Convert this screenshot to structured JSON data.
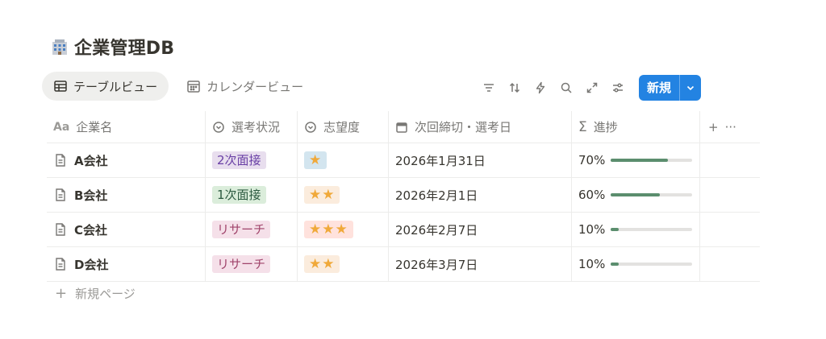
{
  "page": {
    "title": "企業管理DB",
    "title_icon": "office-building-icon"
  },
  "tabs": [
    {
      "label": "テーブルビュー",
      "icon": "table-icon",
      "active": true
    },
    {
      "label": "カレンダービュー",
      "icon": "calendar-icon",
      "active": false
    }
  ],
  "toolbar": {
    "icons": [
      "filter-icon",
      "sort-icon",
      "lightning-icon",
      "search-icon",
      "expand-icon",
      "settings-sliders-icon"
    ],
    "new_label": "新規",
    "accent": "#2383e2"
  },
  "columns": [
    {
      "label": "企業名",
      "icon": "text-aa-icon"
    },
    {
      "label": "選考状況",
      "icon": "status-icon"
    },
    {
      "label": "志望度",
      "icon": "status-icon"
    },
    {
      "label": "次回締切・選考日",
      "icon": "calendar-icon"
    },
    {
      "label": "進捗",
      "icon": "sigma-icon"
    }
  ],
  "header_actions": {
    "add": "+",
    "more": "···"
  },
  "rows": [
    {
      "name": "A会社",
      "status": "2次面接",
      "status_bg": "#e8deee",
      "status_fg": "#6940a5",
      "stars": "★",
      "stars_bg": "#d3e5ef",
      "date": "2026年1月31日",
      "progress_label": "70%",
      "progress": 0.7
    },
    {
      "name": "B会社",
      "status": "1次面接",
      "status_bg": "#dbeddb",
      "status_fg": "#2b593f",
      "stars": "★★",
      "stars_bg": "#fbecdd",
      "date": "2026年2月1日",
      "progress_label": "60%",
      "progress": 0.6
    },
    {
      "name": "C会社",
      "status": "リサーチ",
      "status_bg": "#f5e0e9",
      "status_fg": "#a0446b",
      "stars": "★★★",
      "stars_bg": "#ffe2dd",
      "date": "2026年2月7日",
      "progress_label": "10%",
      "progress": 0.1
    },
    {
      "name": "D会社",
      "status": "リサーチ",
      "status_bg": "#f5e0e9",
      "status_fg": "#a0446b",
      "stars": "★★",
      "stars_bg": "#fbecdd",
      "date": "2026年3月7日",
      "progress_label": "10%",
      "progress": 0.1
    }
  ],
  "add_page": {
    "label": "新規ページ",
    "icon": "plus-icon"
  }
}
